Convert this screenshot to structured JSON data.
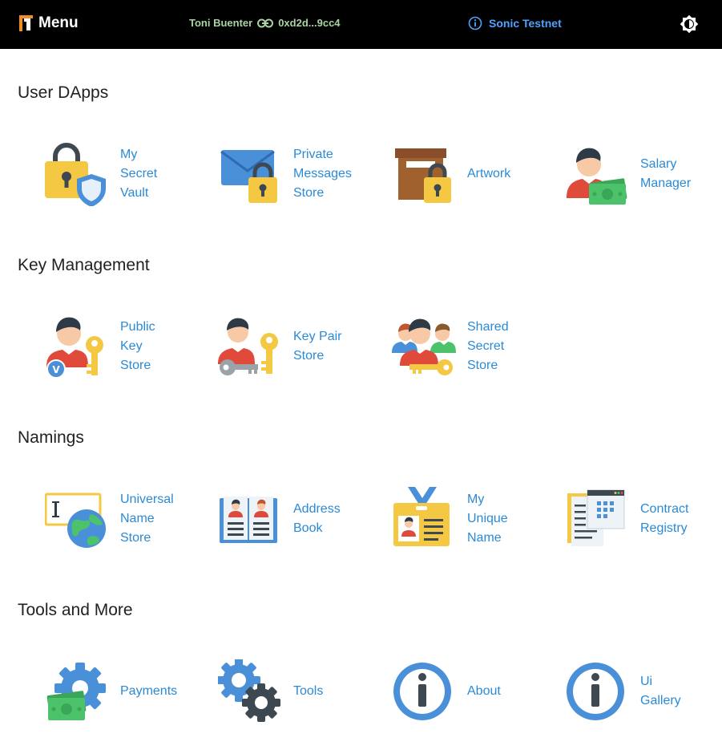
{
  "header": {
    "menu_label": "Menu",
    "account_name": "Toni Buenter",
    "account_address": "0xd2d...9cc4",
    "network": "Sonic Testnet",
    "accent_color": "#4da3ff",
    "account_color": "#a8d5a2"
  },
  "sections": [
    {
      "title": "User DApps",
      "items": [
        {
          "label_lines": [
            "My",
            "Secret",
            "Vault"
          ],
          "icon": "lock-shield-icon"
        },
        {
          "label_lines": [
            "Private",
            "Messages",
            "Store"
          ],
          "icon": "envelope-lock-icon"
        },
        {
          "label_lines": [
            "Artwork"
          ],
          "icon": "box-lock-icon"
        },
        {
          "label_lines": [
            "Salary",
            "Manager"
          ],
          "icon": "person-money-icon"
        }
      ]
    },
    {
      "title": "Key Management",
      "items": [
        {
          "label_lines": [
            "Public",
            "Key",
            "Store"
          ],
          "icon": "person-key-icon"
        },
        {
          "label_lines": [
            "Key Pair",
            "Store"
          ],
          "icon": "person-keypair-icon"
        },
        {
          "label_lines": [
            "Shared",
            "Secret",
            "Store"
          ],
          "icon": "group-key-icon"
        }
      ]
    },
    {
      "title": "Namings",
      "items": [
        {
          "label_lines": [
            "Universal",
            "Name",
            "Store"
          ],
          "icon": "globe-name-icon"
        },
        {
          "label_lines": [
            "Address",
            "Book"
          ],
          "icon": "address-book-icon"
        },
        {
          "label_lines": [
            "My",
            "Unique",
            "Name"
          ],
          "icon": "id-badge-icon"
        },
        {
          "label_lines": [
            "Contract",
            "Registry"
          ],
          "icon": "document-registry-icon"
        }
      ]
    },
    {
      "title": "Tools and More",
      "items": [
        {
          "label_lines": [
            "Payments"
          ],
          "icon": "gear-money-icon"
        },
        {
          "label_lines": [
            "Tools"
          ],
          "icon": "gears-icon"
        },
        {
          "label_lines": [
            "About"
          ],
          "icon": "info-icon"
        },
        {
          "label_lines": [
            "Ui",
            "Gallery"
          ],
          "icon": "info-icon"
        }
      ]
    }
  ]
}
